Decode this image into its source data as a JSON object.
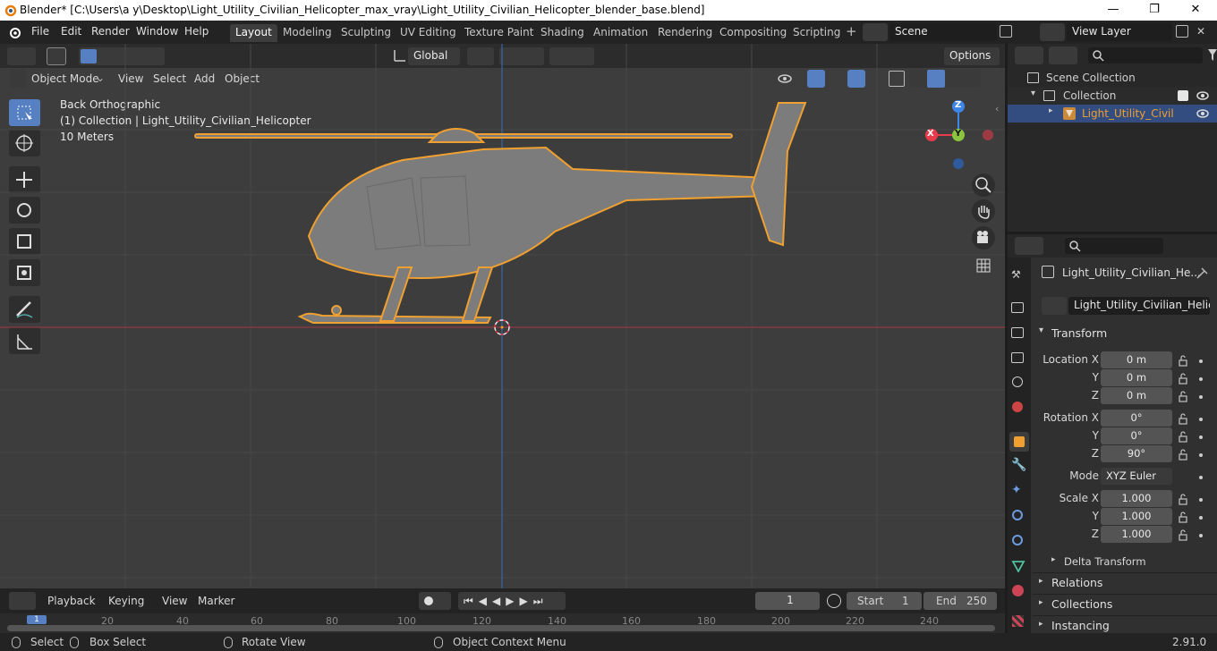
{
  "window": {
    "title": "Blender* [C:\\Users\\a y\\Desktop\\Light_Utility_Civilian_Helicopter_max_vray\\Light_Utility_Civilian_Helicopter_blender_base.blend]"
  },
  "menu": [
    "File",
    "Edit",
    "Render",
    "Window",
    "Help"
  ],
  "workspaces": [
    "Layout",
    "Modeling",
    "Sculpting",
    "UV Editing",
    "Texture Paint",
    "Shading",
    "Animation",
    "Rendering",
    "Compositing",
    "Scripting"
  ],
  "scene": "Scene",
  "view_layer": "View Layer",
  "header": {
    "orientation": "Global",
    "options": "Options"
  },
  "viewport_header": {
    "mode": "Object Mode",
    "view": "View",
    "select": "Select",
    "add": "Add",
    "object": "Object"
  },
  "viewport_info": {
    "view_name": "Back Orthographic",
    "collection": "(1) Collection | Light_Utility_Civilian_Helicopter",
    "scale": "10 Meters"
  },
  "gizmo": {
    "z": "Z",
    "y": "Y",
    "x": "X"
  },
  "outliner": {
    "scene_collection": "Scene Collection",
    "collection": "Collection",
    "object": "Light_Utility_Civilian"
  },
  "properties": {
    "object_name": "Light_Utility_Civilian_He...",
    "data_name": "Light_Utility_Civilian_Helico...",
    "transform_label": "Transform",
    "location": {
      "label": "Location X",
      "x": "0 m",
      "y": "0 m",
      "z": "0 m"
    },
    "rotation": {
      "label": "Rotation X",
      "x": "0°",
      "y": "0°",
      "z": "90°"
    },
    "mode": {
      "label": "Mode",
      "value": "XYZ Euler"
    },
    "scale": {
      "label": "Scale X",
      "x": "1.000",
      "y": "1.000",
      "z": "1.000"
    },
    "axis": {
      "y": "Y",
      "z": "Z"
    },
    "delta_transform": "Delta Transform",
    "relations": "Relations",
    "collections": "Collections",
    "instancing": "Instancing"
  },
  "timeline": {
    "playback": "Playback",
    "keying": "Keying",
    "view": "View",
    "marker": "Marker",
    "current_frame": "1",
    "start_label": "Start",
    "start": "1",
    "end_label": "End",
    "end": "250",
    "ticks": [
      "20",
      "40",
      "60",
      "80",
      "100",
      "120",
      "140",
      "160",
      "180",
      "200",
      "220",
      "240"
    ],
    "cur": "1"
  },
  "status": {
    "select": "Select",
    "box_select": "Box Select",
    "rotate": "Rotate View",
    "context": "Object Context Menu",
    "version": "2.91.0"
  },
  "colors": {
    "accent": "#5680c2",
    "selection": "#f0a030",
    "x_axis": "#e83c4c",
    "y_axis": "#8bc53f",
    "z_axis": "#3d85e6"
  }
}
